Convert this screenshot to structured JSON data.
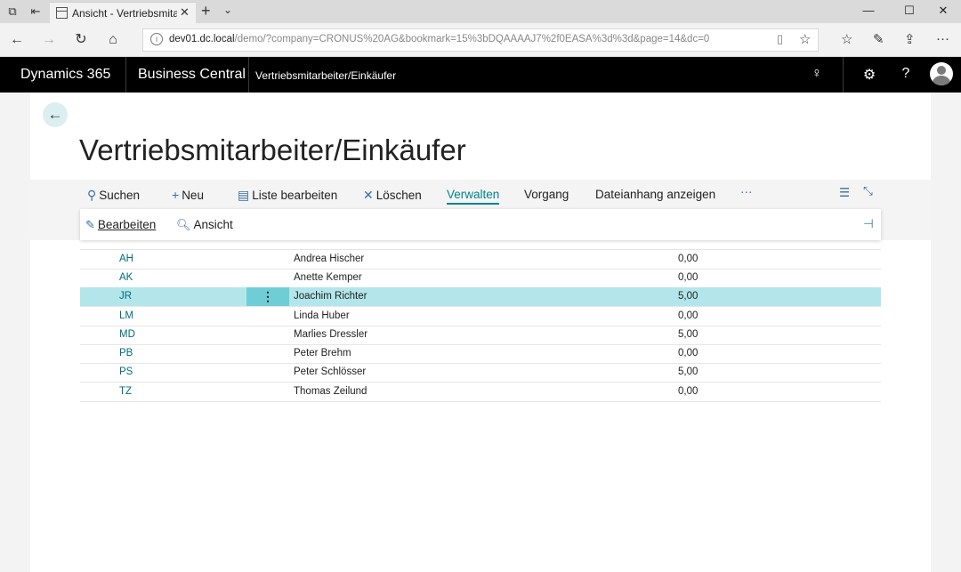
{
  "browser": {
    "tab_title": "Ansicht - Vertriebsmitar",
    "url_host": "dev01.dc.local",
    "url_rest": "/demo/?company=CRONUS%20AG&bookmark=15%3bDQAAAAJ7%2f0EASA%3d%3d&page=14&dc=0"
  },
  "header": {
    "product": "Dynamics 365",
    "app": "Business Central",
    "breadcrumb": "Vertriebsmitarbeiter/Einkäufer"
  },
  "page": {
    "title": "Vertriebsmitarbeiter/Einkäufer"
  },
  "actions": {
    "search": "Suchen",
    "new": "Neu",
    "edit_list": "Liste bearbeiten",
    "delete": "Löschen",
    "manage": "Verwalten",
    "process": "Vorgang",
    "attachment": "Dateianhang anzeigen",
    "more": "···"
  },
  "subactions": {
    "edit": "Bearbeiten",
    "view": "Ansicht"
  },
  "rows": [
    {
      "code": "AH",
      "name": "Andrea Hischer",
      "value": "0,00"
    },
    {
      "code": "AK",
      "name": "Anette Kemper",
      "value": "0,00"
    },
    {
      "code": "JR",
      "name": "Joachim Richter",
      "value": "5,00"
    },
    {
      "code": "LM",
      "name": "Linda Huber",
      "value": "0,00"
    },
    {
      "code": "MD",
      "name": "Marlies Dressler",
      "value": "5,00"
    },
    {
      "code": "PB",
      "name": "Peter Brehm",
      "value": "0,00"
    },
    {
      "code": "PS",
      "name": "Peter Schlösser",
      "value": "5,00"
    },
    {
      "code": "TZ",
      "name": "Thomas Zeilund",
      "value": "0,00"
    }
  ],
  "colors": {
    "accent": "#00838f",
    "selected_row": "#b3e6ea"
  }
}
